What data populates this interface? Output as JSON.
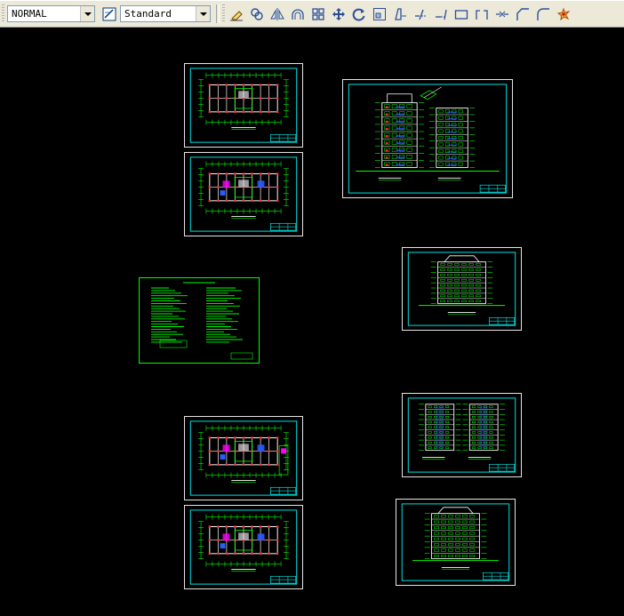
{
  "toolbar": {
    "style_combo": {
      "value": "NORMAL"
    },
    "dimstyle_combo": {
      "value": "Standard"
    },
    "icons": [
      "dimstyle-icon",
      "erase-icon",
      "copy-icon",
      "mirror-icon",
      "offset-icon",
      "array-icon",
      "move-icon",
      "rotate-icon",
      "scale-icon",
      "stretch-icon",
      "trim-icon",
      "extend-icon",
      "break-icon",
      "break-at-point-icon",
      "join-icon",
      "chamfer-icon",
      "fillet-icon",
      "explode-icon"
    ]
  },
  "colors": {
    "toolbar_bg": "#ece9d8",
    "model_bg": "#000000",
    "border": "#e6e6e6",
    "frame": "#00e5e5",
    "linework": "#00ff00",
    "accent_red": "#ff2b2b",
    "accent_white": "#ffffff",
    "accent_magenta": "#ff00ff",
    "accent_blue": "#2a5cff"
  },
  "sheets": [
    {
      "id": "plan-1",
      "kind": "floor-plan"
    },
    {
      "id": "plan-2",
      "kind": "floor-plan"
    },
    {
      "id": "sections",
      "kind": "section"
    },
    {
      "id": "elevation-1",
      "kind": "elevation"
    },
    {
      "id": "notes",
      "kind": "notes"
    },
    {
      "id": "elevations-pair",
      "kind": "elevation-pair"
    },
    {
      "id": "plan-3",
      "kind": "floor-plan"
    },
    {
      "id": "plan-4",
      "kind": "floor-plan"
    },
    {
      "id": "elevation-2",
      "kind": "elevation"
    }
  ]
}
